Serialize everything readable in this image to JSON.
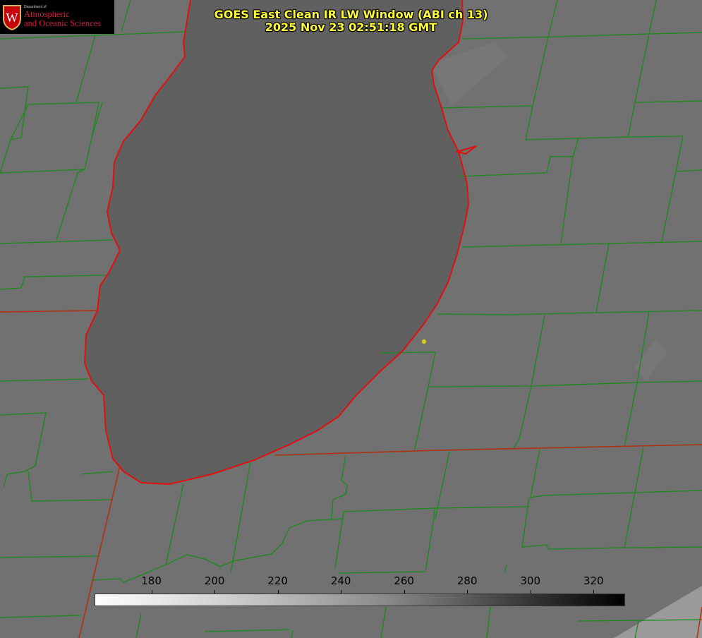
{
  "title": {
    "line1": "GOES East Clean IR LW Window (ABI ch 13)",
    "line2": "2025 Nov 23 02:51:18 GMT"
  },
  "logo": {
    "dept": "Department of",
    "line1": "Atmospheric",
    "line2": "and Oceanic Sciences",
    "crest_letter": "W"
  },
  "colorbar": {
    "ticks": [
      "180",
      "200",
      "220",
      "240",
      "260",
      "280",
      "300",
      "320"
    ],
    "range": [
      162,
      330
    ],
    "colormap": "grayscale, white = cold, black = warm"
  },
  "colors": {
    "background_gray": "#717171",
    "lake_gray": "#606060",
    "county_lines": "#1a8a1a",
    "state_lines": "#b03010",
    "coastline": "#e01010",
    "title_text": "#ffff3a",
    "marker_dot": "#d8c81a",
    "logo_red": "#d01c3c"
  },
  "map": {
    "features": [
      "lake-michigan",
      "county-borders",
      "state-borders",
      "coastline",
      "city-marker"
    ]
  }
}
